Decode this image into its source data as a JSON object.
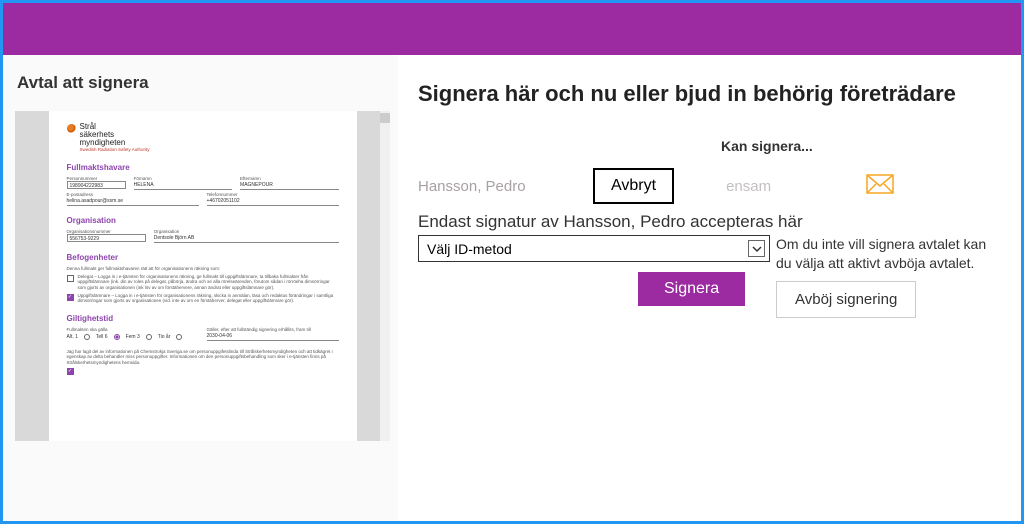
{
  "colors": {
    "primary": "#9c2aa0",
    "border_highlight": "#2196f3",
    "mail_icon": "#f5a623"
  },
  "left": {
    "title": "Avtal att signera",
    "doc": {
      "logo": {
        "l1": "Strål",
        "l2": "säkerhets",
        "l3": "myndigheten",
        "sub": "Swedish Radiation Safety Authority"
      },
      "s1": "Fullmaktshavare",
      "f1_label": "Personnummer",
      "f1_val": "198904222983",
      "f2_label": "Förnamn",
      "f2_val": "HELENA",
      "f3_label": "Efternamn",
      "f3_val": "MAGNEPOUR",
      "f4_label": "E-postadress",
      "f4_val": "helina.asadpour@ssm.se",
      "f5_label": "Telefonnummer",
      "f5_val": "+46702051102",
      "s2": "Organisation",
      "f6_label": "Organisationsnummer",
      "f6_val": "556753-9229",
      "f7_label": "Organisation",
      "f7_val": "Dentsole Björn AB",
      "s3": "Befogenheter",
      "p1": "Denna fullmakt ger fullmaktshavaren rätt att för organisationens räkning som:",
      "c1": "Delegat – Logga in i e-tjänsten för organisationens räkning, ge fullmakt till uppgiftslämnare, ta tillbaka fullmakter från uppgiftslämnare (ink. din av roles på delegat, påbörja, ändra och se alla rörelseärenden, förutom sådan i rörröeha dimsörringar som gjorts av organisationen (ink löv av om förstähervere, annan ändrat eller uppgiftslämnare gör).",
      "c2": "Uppgiftslämnare – Logga in i e-tjänsten för organisationens räkning, skicka in anmälan, läsa och redaktus förändringar i samtliga dimsörringar som gjorts av organisationen (vid. inte av om en förstäherver, delegat eller uppgiftslämrare gör).",
      "s4": "Giltighetstid",
      "g_label": "Fullmakten ska gälla",
      "r1": "Alt. 1",
      "r2": "Tell 6",
      "r3": "Fem 3",
      "r4": "Tio år",
      "g2_label": "Gäller, efter att fullständig signering erhållits, fram till",
      "g2_val": "2030-04-06",
      "ack": "Jag har lagit del av informationen på Chemstrokja Sveriga.se om personuppgifetslinda till Strålskerhetsmyndigheten och att tidkägret i egenskap av delta behandler miss personuppgifter. Informationen om den personuppgiftsbehandling som sker i e-tjänsten finns på Strålskerhetsmyndighetens hemsida."
    }
  },
  "right": {
    "title": "Signera här och nu eller bjud in behörig företrädare",
    "can_sign": "Kan signera...",
    "signer_name": "Hansson, Pedro",
    "cancel": "Avbryt",
    "alone": "ensam",
    "accept_line": "Endast signatur av Hansson, Pedro accepteras här",
    "select_placeholder": "Välj ID-metod",
    "sign": "Signera",
    "decline_note": "Om du inte vill signera avtalet kan du välja att aktivt avböja avtalet.",
    "decline": "Avböj signering"
  }
}
